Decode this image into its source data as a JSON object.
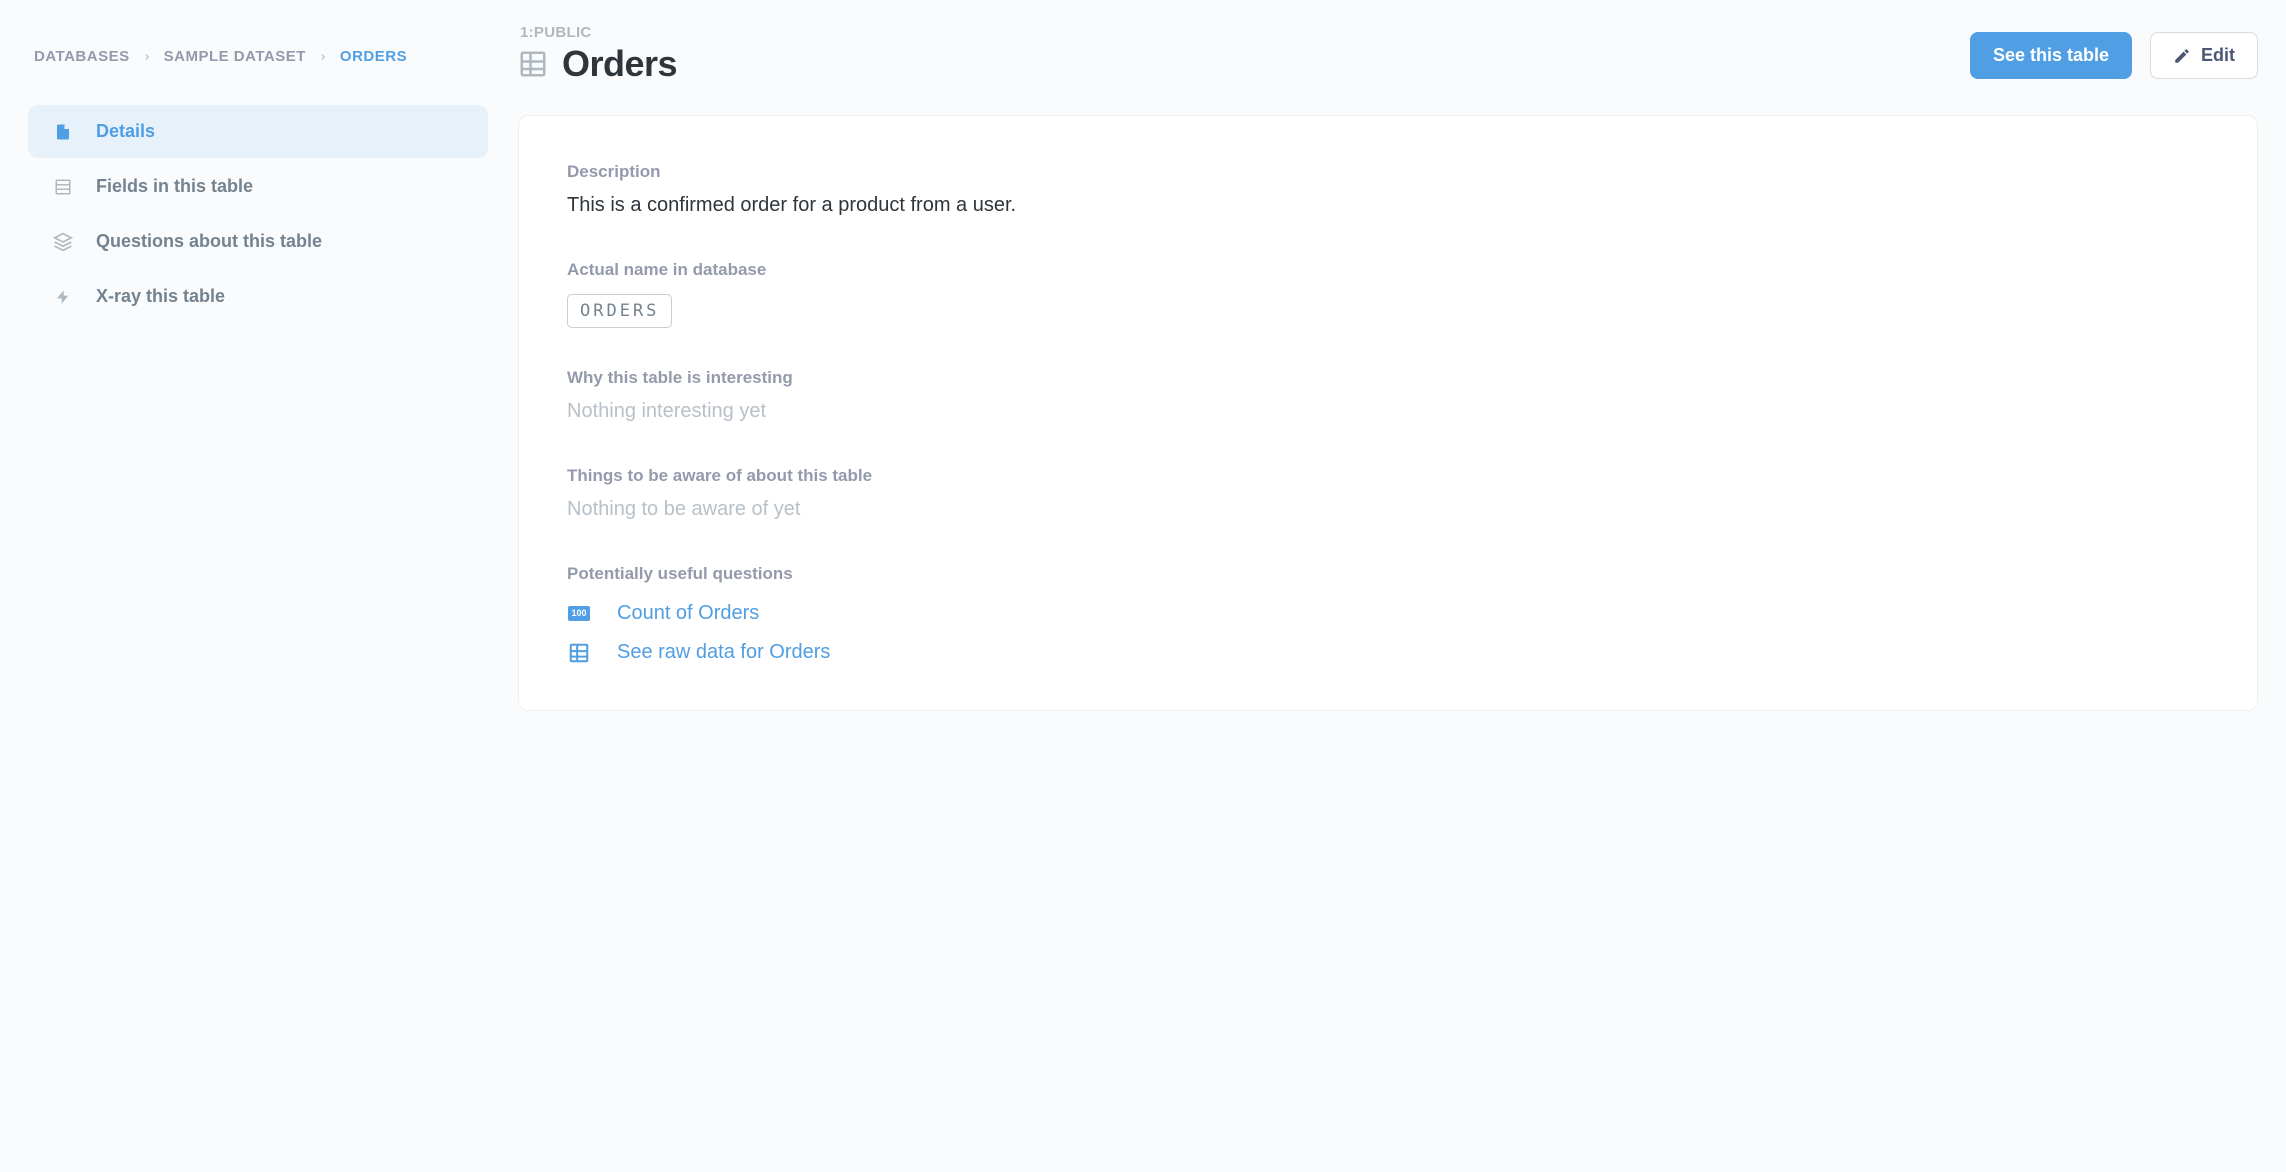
{
  "breadcrumbs": [
    {
      "label": "DATABASES",
      "active": false
    },
    {
      "label": "SAMPLE DATASET",
      "active": false
    },
    {
      "label": "ORDERS",
      "active": true
    }
  ],
  "sidebar": {
    "items": [
      {
        "label": "Details",
        "icon": "file-icon",
        "active": true
      },
      {
        "label": "Fields in this table",
        "icon": "fields-icon",
        "active": false
      },
      {
        "label": "Questions about this table",
        "icon": "stack-icon",
        "active": false
      },
      {
        "label": "X-ray this table",
        "icon": "bolt-icon",
        "active": false
      }
    ]
  },
  "header": {
    "schema": "1:PUBLIC",
    "title": "Orders",
    "see_table_label": "See this table",
    "edit_label": "Edit"
  },
  "details": {
    "description_label": "Description",
    "description_text": "This is a confirmed order for a product from a user.",
    "actual_name_label": "Actual name in database",
    "actual_name_value": "ORDERS",
    "interesting_label": "Why this table is interesting",
    "interesting_text": "Nothing interesting yet",
    "aware_label": "Things to be aware of about this table",
    "aware_text": "Nothing to be aware of yet",
    "questions_label": "Potentially useful questions",
    "questions": [
      {
        "label": "Count of Orders",
        "icon": "count-icon",
        "badge": "100"
      },
      {
        "label": "See raw data for Orders",
        "icon": "table-icon"
      }
    ]
  }
}
